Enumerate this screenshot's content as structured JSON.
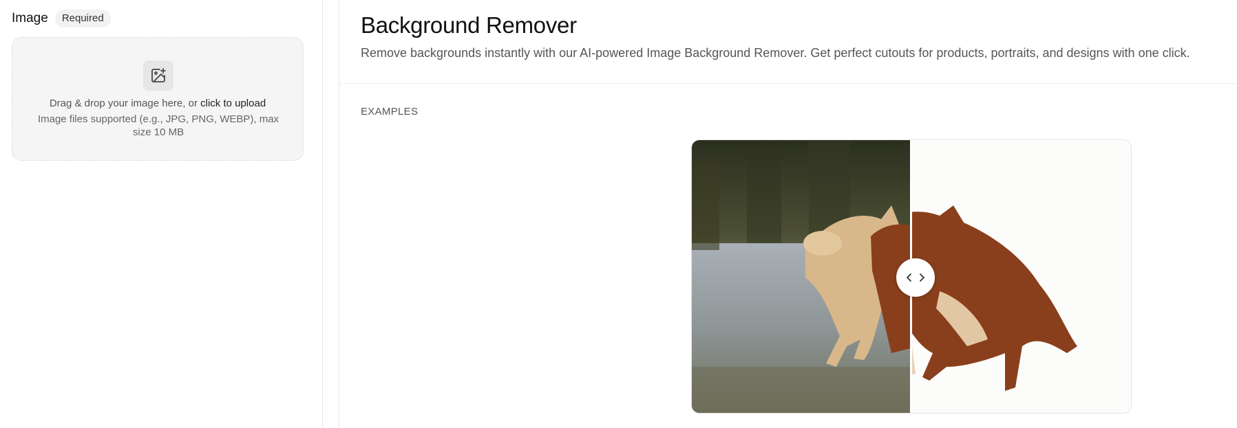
{
  "form": {
    "image_field": {
      "label": "Image",
      "badge": "Required"
    },
    "dropzone": {
      "prompt": "Drag & drop your image here, or ",
      "link_text": "click to upload",
      "hint": "Image files supported (e.g., JPG, PNG, WEBP), max size 10 MB",
      "icon": "image-add-icon"
    }
  },
  "main": {
    "title": "Background Remover",
    "description": "Remove backgrounds instantly with our AI-powered Image Background Remover. Get perfect cutouts for products, portraits, and designs with one click.",
    "examples_label": "EXAMPLES",
    "comparison": {
      "before_image": "dog-original-photo",
      "after_image": "dog-background-removed",
      "handle_icons": [
        "chevron-left-icon",
        "chevron-right-icon"
      ],
      "split_position": 0.5
    }
  },
  "colors": {
    "text_primary": "#111111",
    "text_secondary": "#555555",
    "dropzone_bg": "#f5f5f5",
    "badge_bg": "#f2f2f2",
    "border": "#e6e6e6"
  }
}
